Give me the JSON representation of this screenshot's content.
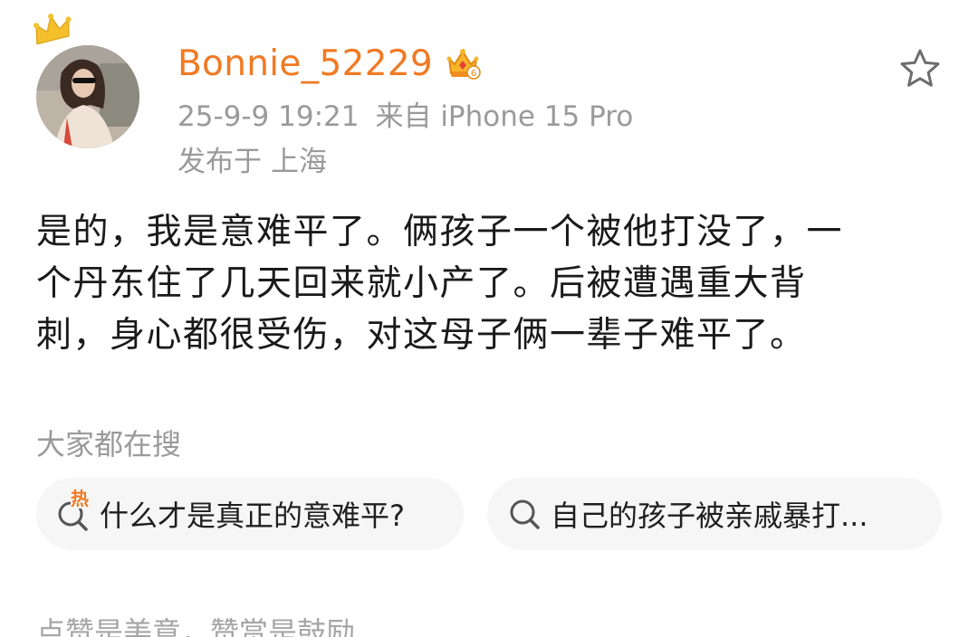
{
  "user": {
    "name": "Bonnie_52229",
    "avatar": "avatar",
    "crown_icon": "crown-icon",
    "vip_badge_icon": "vip-crown-badge-icon",
    "name_color": "#f07a24"
  },
  "meta": {
    "time": "25-9-9 19:21",
    "source": "来自 iPhone 15 Pro",
    "location_prefix": "发布于",
    "location": "上海"
  },
  "actions": {
    "favorite_icon": "star-icon"
  },
  "post": {
    "lines": [
      "是的，我是意难平了。俩孩子一个被他打没了，一",
      "个丹东住了几天回来就小产了。后被遭遇重大背",
      "刺，身心都很受伤，对这母子俩一辈子难平了。"
    ]
  },
  "search": {
    "heading": "大家都在搜",
    "suggestions": [
      {
        "icon": "hot-search-icon",
        "badge": "热",
        "text": "什么才是真正的意难平?"
      },
      {
        "icon": "search-icon",
        "text": "自己的孩子被亲戚暴打..."
      }
    ]
  },
  "footer": {
    "note": "点赞是美意，赞赏是鼓励"
  }
}
